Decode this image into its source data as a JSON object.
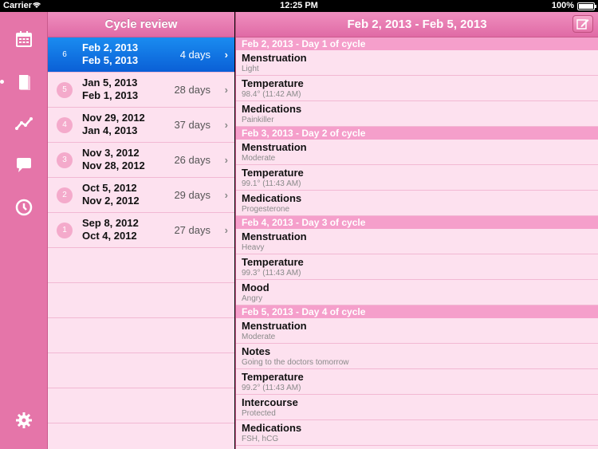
{
  "status_bar": {
    "carrier": "Carrier",
    "time": "12:25 PM",
    "battery": "100%"
  },
  "rail": {
    "items": [
      {
        "name": "calendar-icon"
      },
      {
        "name": "journal-icon"
      },
      {
        "name": "chart-icon"
      },
      {
        "name": "chat-icon"
      },
      {
        "name": "clock-icon"
      },
      {
        "name": "settings-icon"
      }
    ]
  },
  "cycle_list": {
    "title": "Cycle review",
    "cycles": [
      {
        "num": "6",
        "start": "Feb 2, 2013",
        "end": "Feb 5, 2013",
        "days": "4 days",
        "selected": true
      },
      {
        "num": "5",
        "start": "Jan 5, 2013",
        "end": "Feb 1, 2013",
        "days": "28 days"
      },
      {
        "num": "4",
        "start": "Nov 29, 2012",
        "end": "Jan 4, 2013",
        "days": "37 days"
      },
      {
        "num": "3",
        "start": "Nov 3, 2012",
        "end": "Nov 28, 2012",
        "days": "26 days"
      },
      {
        "num": "2",
        "start": "Oct 5, 2012",
        "end": "Nov 2, 2012",
        "days": "29 days"
      },
      {
        "num": "1",
        "start": "Sep 8, 2012",
        "end": "Oct 4, 2012",
        "days": "27 days"
      }
    ]
  },
  "detail": {
    "title": "Feb 2, 2013 - Feb 5, 2013",
    "sections": [
      {
        "header": "Feb 2, 2013 - Day 1 of cycle",
        "entries": [
          {
            "title": "Menstruation",
            "sub": "Light"
          },
          {
            "title": "Temperature",
            "sub": "98.4° (11:42 AM)"
          },
          {
            "title": "Medications",
            "sub": "Painkiller"
          }
        ]
      },
      {
        "header": "Feb 3, 2013 - Day 2 of cycle",
        "entries": [
          {
            "title": "Menstruation",
            "sub": "Moderate"
          },
          {
            "title": "Temperature",
            "sub": "99.1° (11:43 AM)"
          },
          {
            "title": "Medications",
            "sub": "Progesterone"
          }
        ]
      },
      {
        "header": "Feb 4, 2013 - Day 3 of cycle",
        "entries": [
          {
            "title": "Menstruation",
            "sub": "Heavy"
          },
          {
            "title": "Temperature",
            "sub": "99.3° (11:43 AM)"
          },
          {
            "title": "Mood",
            "sub": "Angry"
          }
        ]
      },
      {
        "header": "Feb 5, 2013 - Day 4 of cycle",
        "entries": [
          {
            "title": "Menstruation",
            "sub": "Moderate"
          },
          {
            "title": "Notes",
            "sub": "Going to the doctors tomorrow"
          },
          {
            "title": "Temperature",
            "sub": "99.2° (11:43 AM)"
          },
          {
            "title": "Intercourse",
            "sub": "Protected"
          },
          {
            "title": "Medications",
            "sub": "FSH, hCG"
          }
        ]
      }
    ]
  },
  "colors": {
    "accent_pink": "#e575a9",
    "panel_bg": "#fde1ef",
    "selected_blue": "#0a6fe0"
  }
}
